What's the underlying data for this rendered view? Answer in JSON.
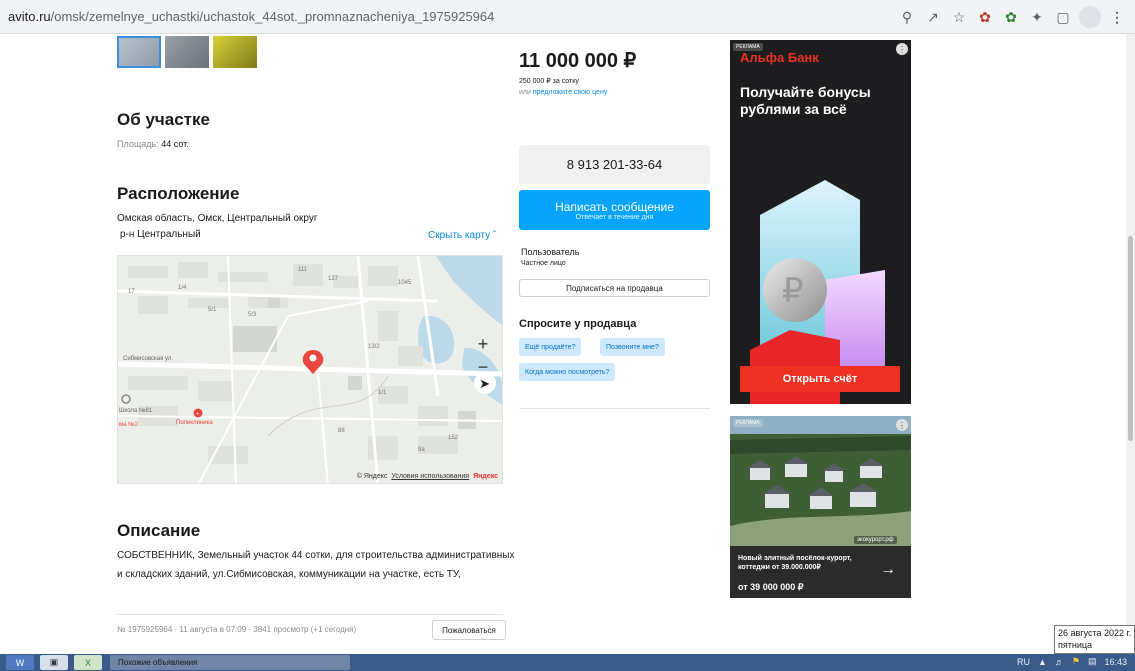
{
  "browser": {
    "url_domain": "avito.ru",
    "url_path": "/omsk/zemelnye_uchastki/uchastok_44sot._promnaznacheniya_1975925964",
    "icons": [
      "zoom-icon",
      "share-icon",
      "bookmark-star-icon",
      "extension-icon",
      "extension-icon",
      "puzzle-icon",
      "sidebar-icon",
      "profile-icon",
      "menu-icon"
    ]
  },
  "about": {
    "title": "Об участке",
    "area_label": "Площадь:",
    "area_value": "44 сот."
  },
  "location": {
    "title": "Расположение",
    "address": "Омская область, Омск, Центральный округ",
    "district": "р-н Центральный",
    "hide_map": "Скрыть карту",
    "map": {
      "street_label": "Сибмисовская ул.",
      "school_label": "Школа №81",
      "school2_label": "ма №2",
      "clinic_label": "Поликлиника",
      "attribution": "© Яндекс",
      "terms": "Условия использования",
      "brand": "Яндекс",
      "zoom_in": "+",
      "zoom_out": "−"
    }
  },
  "description": {
    "title": "Описание",
    "line1": "СОБСТВЕННИК, Земельный участок 44 сотки, для строительства административных",
    "line2": "и складских зданий, ул.Сибмисовская, коммуникации на участке, есть ТУ,"
  },
  "footer": {
    "meta": "№ 1975925964 · 11 августа в 07:09 · 3841 просмотр (+1 сегодня)",
    "complain": "Пожаловаться"
  },
  "price": {
    "value": "11 000 000 ₽",
    "per_unit": "250 000 ₽ за сотку",
    "offer_prefix": "или",
    "offer_link": "предложите свою цену"
  },
  "contact": {
    "phone": "8 913 201-33-64",
    "message_label": "Написать сообщение",
    "message_sub": "Отвечает в течение дня",
    "seller_name": "Пользователь",
    "seller_type": "Частное лицо",
    "subscribe": "Подписаться на продавца"
  },
  "ask": {
    "title": "Спросите у продавца",
    "chips": [
      "Ещё продаёте?",
      "Позвоните мне?",
      "Когда можно посмотреть?"
    ]
  },
  "ad1": {
    "tag": "РЕКЛАМА",
    "brand": "Альфа Банк",
    "headline": "Получайте бонусы рублями за всё",
    "cta": "Открыть счёт",
    "colors": {
      "bg": "#1d1d1f",
      "accent": "#ef3124"
    }
  },
  "ad2": {
    "tag": "РЕКЛАМА",
    "site": "экокурорт.рф",
    "text": "Новый элитный посёлок-курорт, коттеджи от 39.000.000₽",
    "price": "от 39 000 000 ₽"
  },
  "datetip": {
    "date": "26 августа 2022 г.",
    "weekday": "пятница"
  },
  "taskbar": {
    "active_window": "Похожие объявления",
    "lang": "RU",
    "time": "16:43"
  }
}
